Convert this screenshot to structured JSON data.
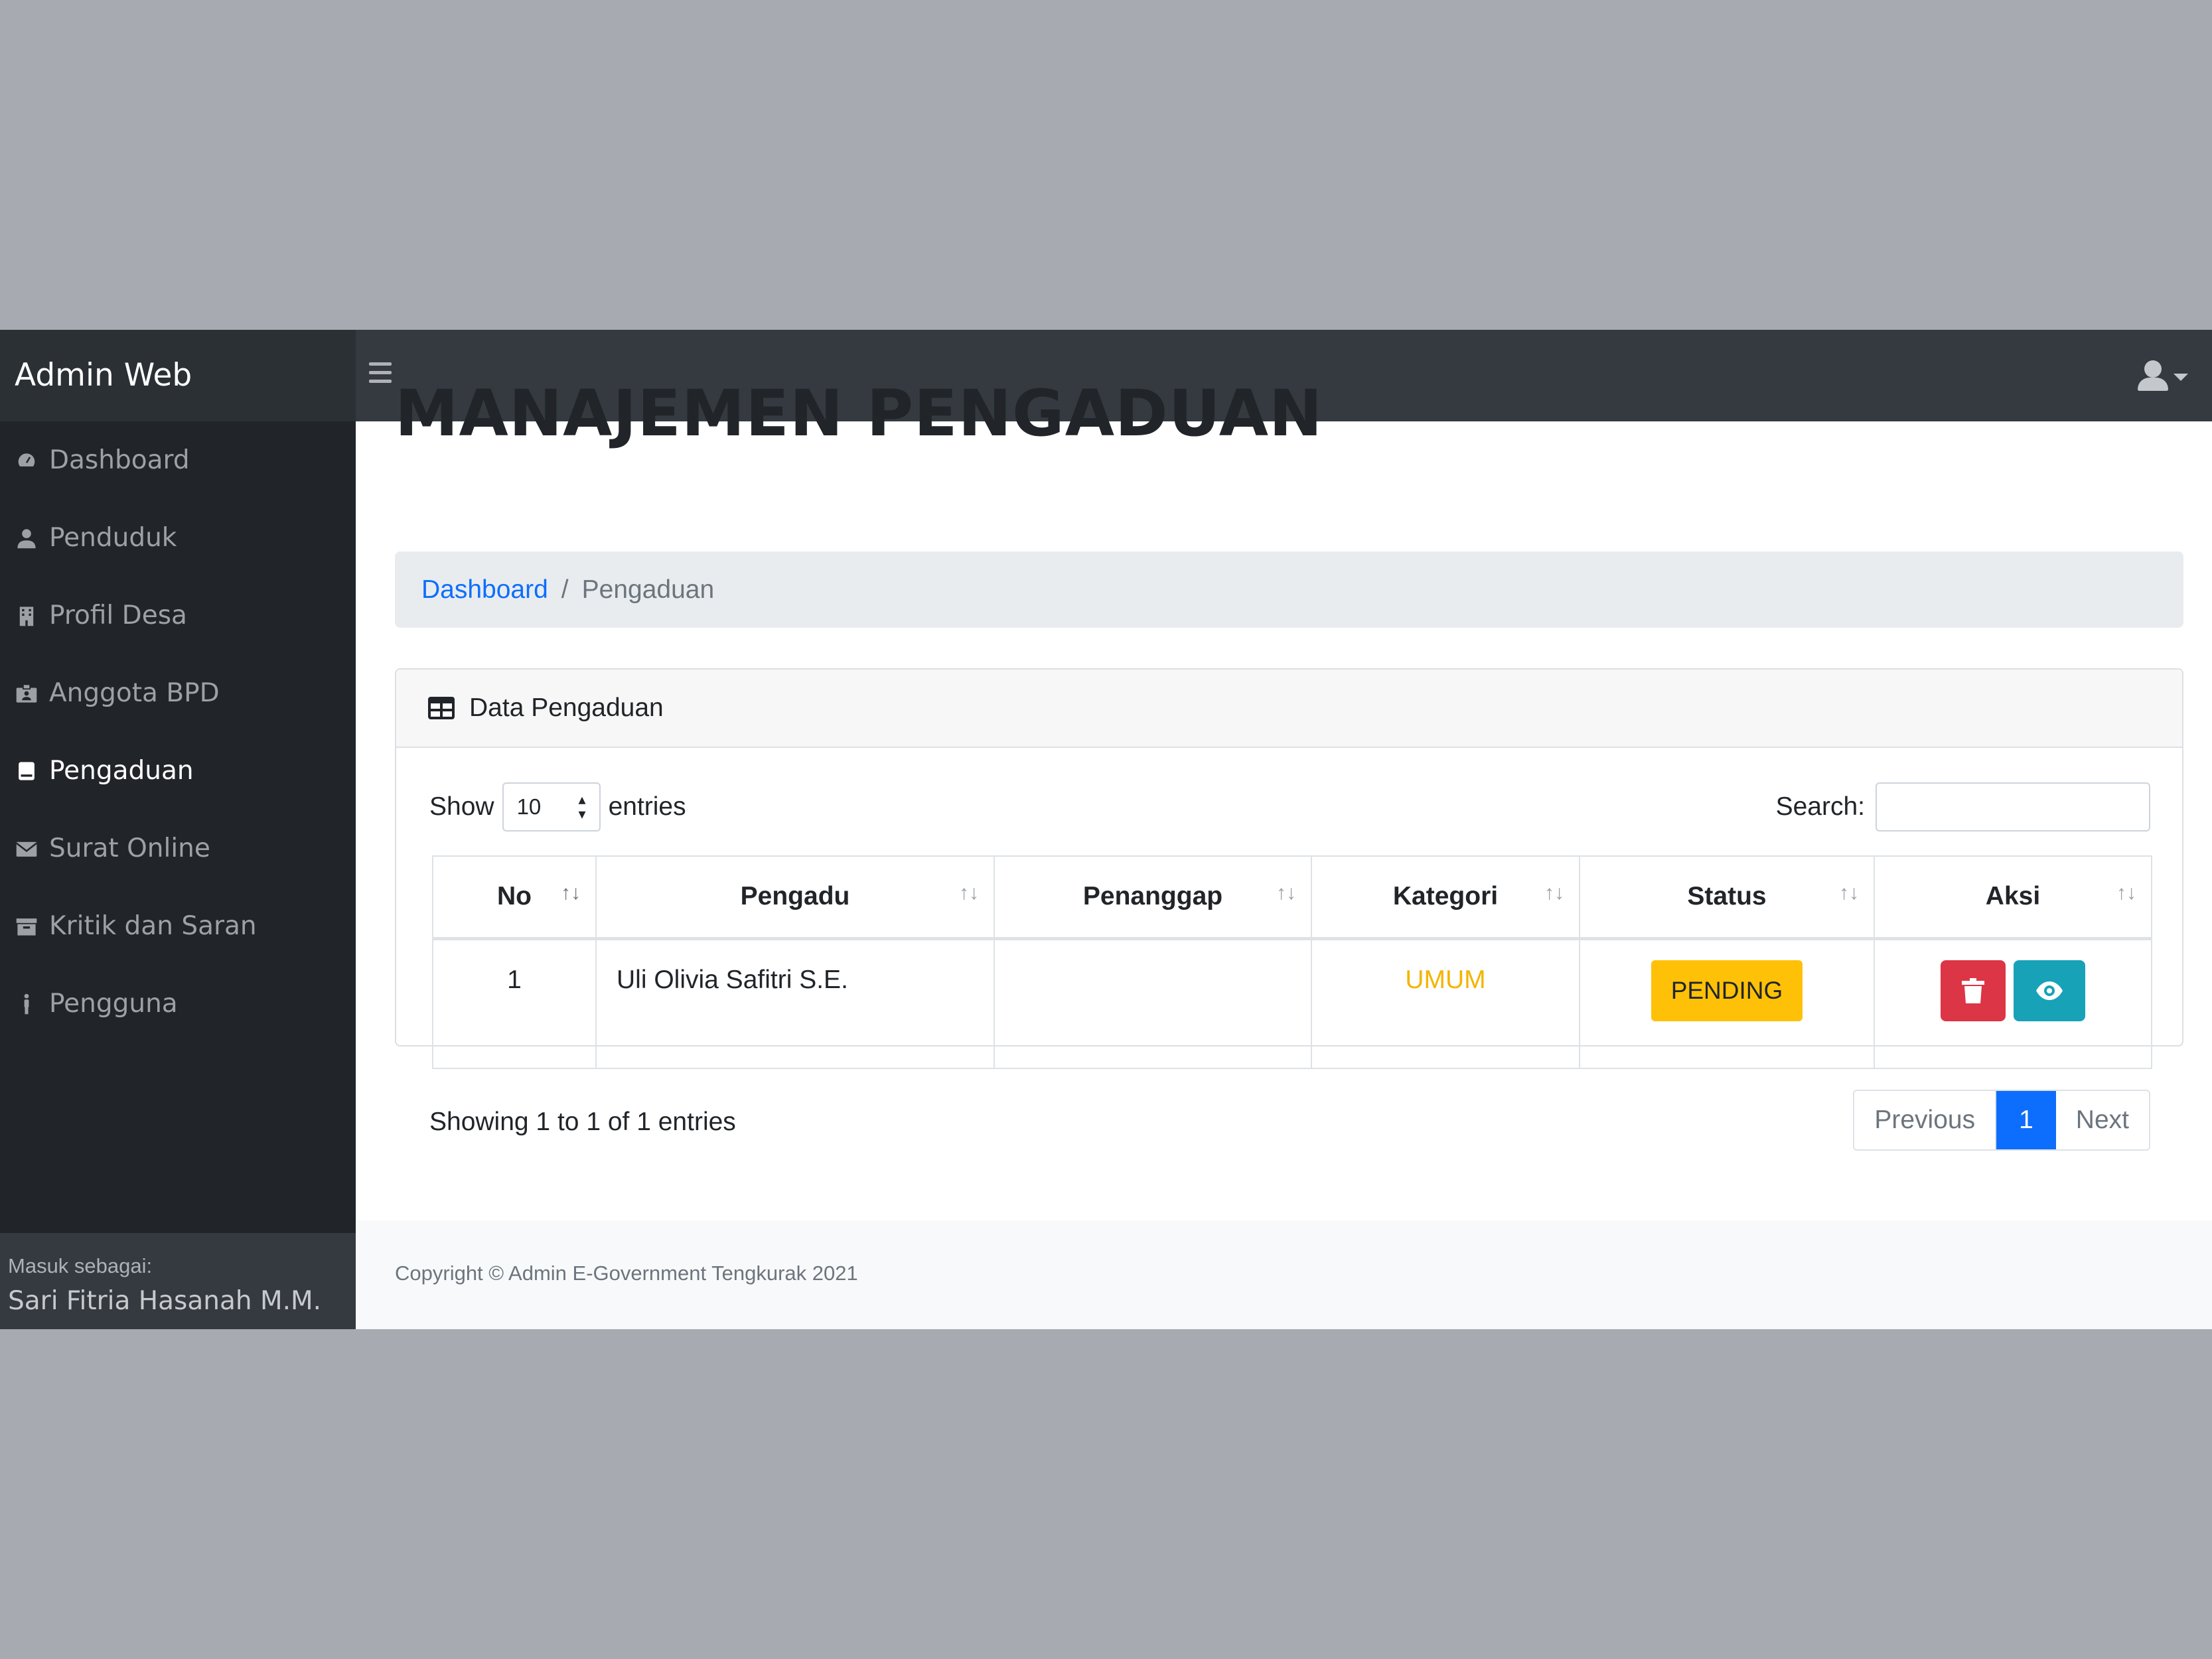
{
  "navbar": {
    "brand": "Admin Web"
  },
  "sidebar": {
    "items": [
      {
        "label": "Dashboard",
        "icon": "tachometer-icon"
      },
      {
        "label": "Penduduk",
        "icon": "user-icon"
      },
      {
        "label": "Profil Desa",
        "icon": "building-icon"
      },
      {
        "label": "Anggota BPD",
        "icon": "id-badge-icon"
      },
      {
        "label": "Pengaduan",
        "icon": "book-icon",
        "active": true
      },
      {
        "label": "Surat Online",
        "icon": "envelope-icon"
      },
      {
        "label": "Kritik dan Saran",
        "icon": "archive-icon"
      },
      {
        "label": "Pengguna",
        "icon": "male-icon"
      }
    ],
    "footer": {
      "label": "Masuk sebagai:",
      "user": "Sari Fitria Hasanah M.M."
    }
  },
  "main": {
    "title": "MANAJEMEN PENGADUAN",
    "breadcrumb": {
      "link": "Dashboard",
      "separator": "/",
      "current": "Pengaduan"
    }
  },
  "card": {
    "header": "Data Pengaduan",
    "show_label": "Show",
    "entries_value": "10",
    "entries_label": "entries",
    "search_label": "Search:",
    "search_value": "",
    "columns": [
      "No",
      "Pengadu",
      "Penanggap",
      "Kategori",
      "Status",
      "Aksi"
    ],
    "rows": [
      {
        "no": "1",
        "pengadu": "Uli Olivia Safitri S.E.",
        "penanggap": "",
        "kategori": "UMUM",
        "status": "PENDING"
      }
    ],
    "info": "Showing 1 to 1 of 1 entries",
    "pagination": {
      "previous": "Previous",
      "page": "1",
      "next": "Next"
    }
  },
  "footer": {
    "copyright": "Copyright © Admin E-Government Tengkurak 2021"
  },
  "colors": {
    "navbar": "#343a40",
    "sidebar": "#212529",
    "link": "#0d6efd",
    "warning": "#ffc107",
    "danger": "#dc3545",
    "info": "#17a2b8",
    "category": "#f4b400"
  }
}
